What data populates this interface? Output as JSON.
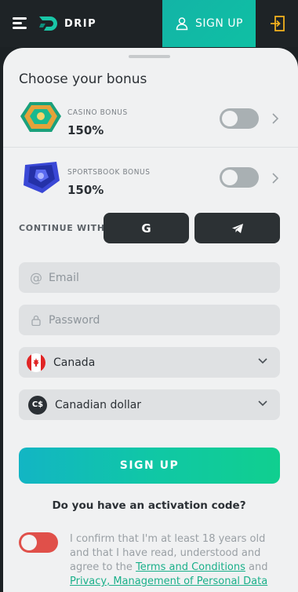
{
  "header": {
    "brand": "DRIP",
    "signup_label": "SIGN UP",
    "icons": [
      "menu-icon",
      "drip-logo",
      "user-icon",
      "login-icon"
    ],
    "accent": "#13b4a6"
  },
  "sheet": {
    "title": "Choose your bonus",
    "bonuses": [
      {
        "label": "CASINO BONUS",
        "value": "150%",
        "enabled": false
      },
      {
        "label": "SPORTSBOOK BONUS",
        "value": "150%",
        "enabled": false
      }
    ],
    "continue_with": "CONTINUE WITH",
    "social": [
      {
        "name": "google",
        "icon": "G"
      },
      {
        "name": "telegram",
        "icon": "telegram-icon"
      }
    ],
    "email_placeholder": "Email",
    "password_placeholder": "Password",
    "country": "Canada",
    "currency": "Canadian dollar",
    "currency_symbol": "C$",
    "signup_button": "SIGN UP",
    "activation_question": "Do you have an activation code?",
    "consent": {
      "text_before": "I confirm that I'm at least 18 years old and that I have read, understood and agree to the",
      "terms_link": "Terms and Conditions",
      "and": "and",
      "privacy_link": "Privacy, Management of Personal Data"
    },
    "consent_toggle_on": false
  }
}
